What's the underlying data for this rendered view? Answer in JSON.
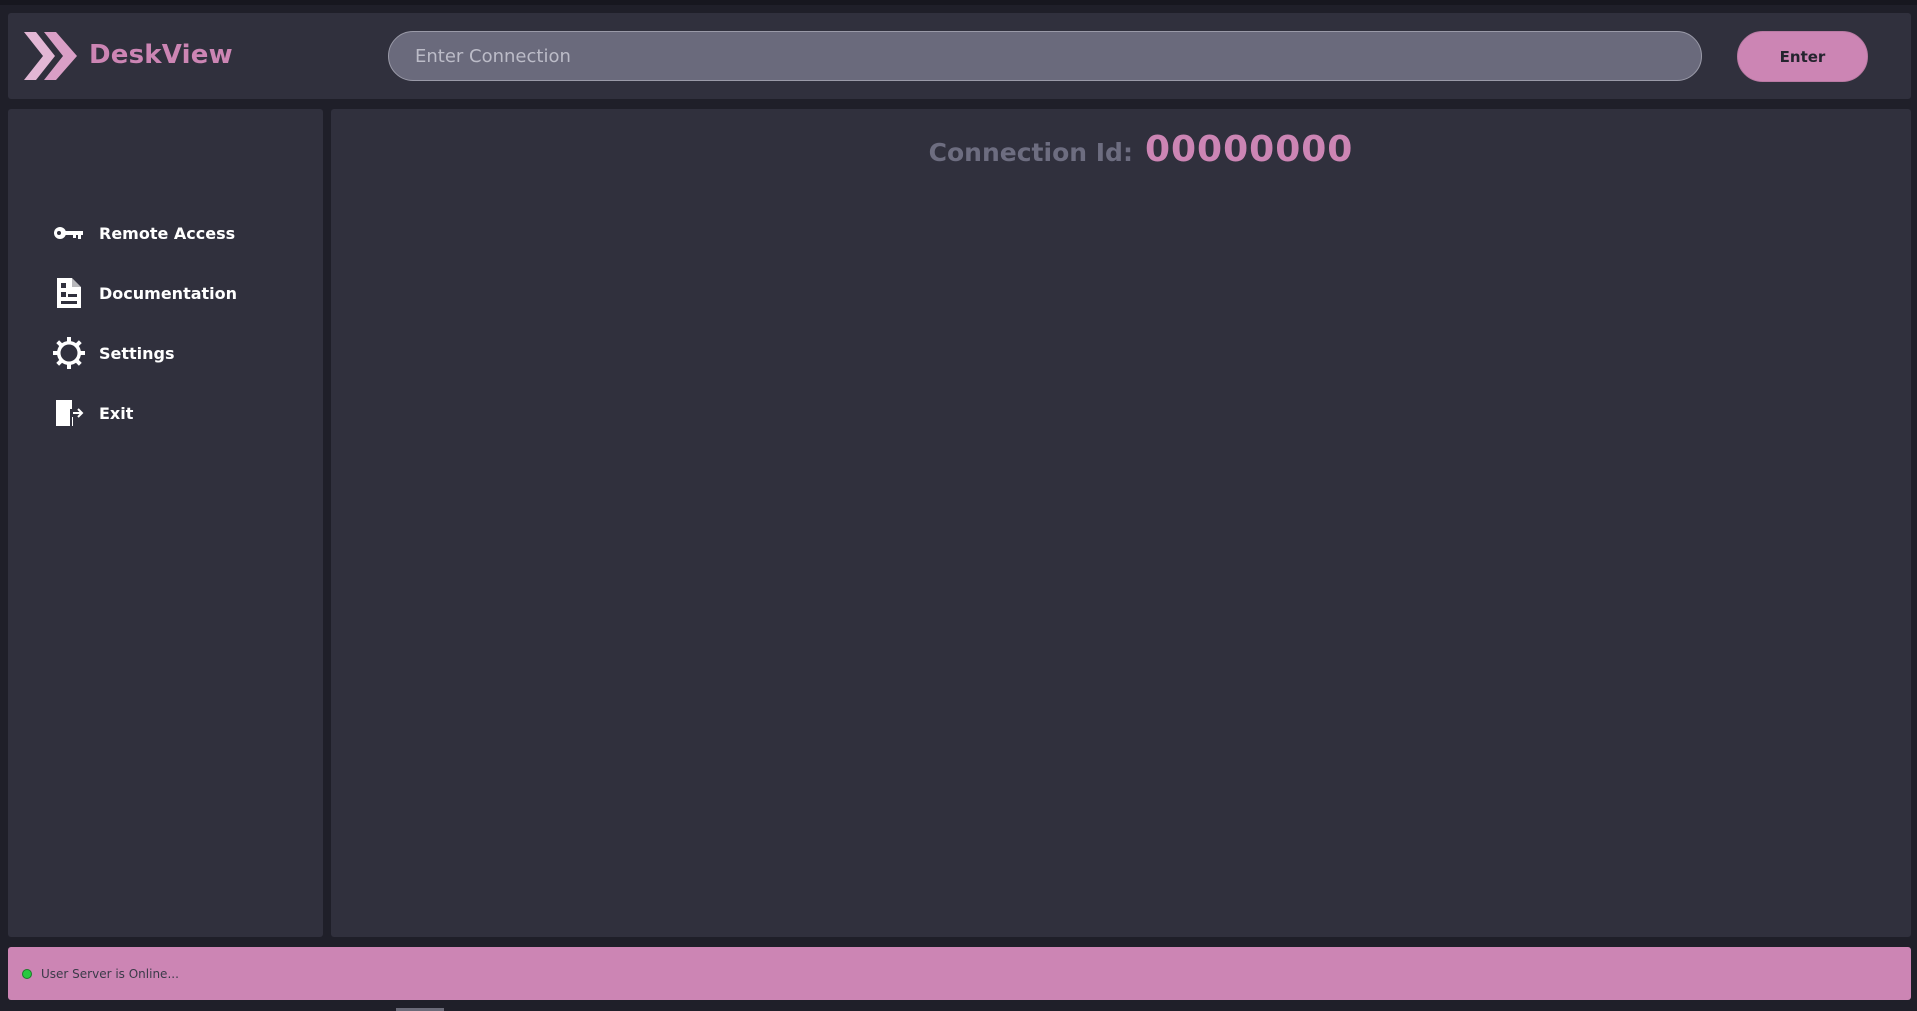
{
  "app": {
    "name": "DeskView",
    "logo_icon": "double-chevron-icon"
  },
  "header": {
    "search_placeholder": "Enter Connection",
    "search_value": "",
    "enter_label": "Enter"
  },
  "sidebar": {
    "items": [
      {
        "label": "Remote Access",
        "icon": "key-icon"
      },
      {
        "label": "Documentation",
        "icon": "document-icon"
      },
      {
        "label": "Settings",
        "icon": "gear-icon"
      },
      {
        "label": "Exit",
        "icon": "exit-icon"
      }
    ]
  },
  "main": {
    "connection_label": "Connection Id:",
    "connection_id": "00000000"
  },
  "status": {
    "text": "User Server is Online...",
    "indicator_color": "#27c93f"
  },
  "colors": {
    "accent": "#cc85b4",
    "panel": "#30303d",
    "background": "#1f1f29"
  }
}
